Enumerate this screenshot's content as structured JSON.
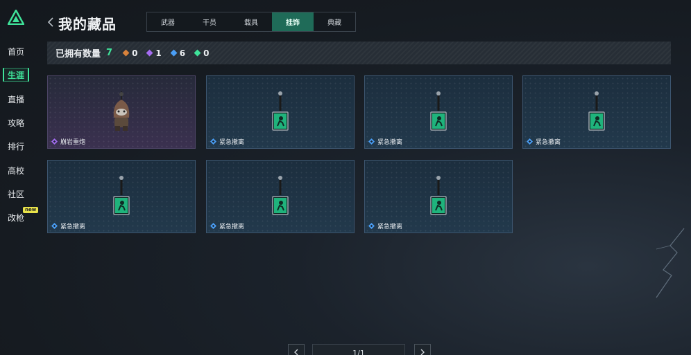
{
  "sidebar": {
    "items": [
      {
        "label": "首页",
        "active": false
      },
      {
        "label": "生涯",
        "active": true
      },
      {
        "label": "直播",
        "active": false
      },
      {
        "label": "攻略",
        "active": false
      },
      {
        "label": "排行",
        "active": false
      },
      {
        "label": "高校",
        "active": false
      },
      {
        "label": "社区",
        "active": false
      },
      {
        "label": "改枪",
        "active": false
      }
    ],
    "new_badge": "new"
  },
  "header": {
    "title": "我的藏品",
    "tabs": [
      {
        "label": "武器",
        "active": false
      },
      {
        "label": "干员",
        "active": false
      },
      {
        "label": "载具",
        "active": false
      },
      {
        "label": "挂饰",
        "active": true
      },
      {
        "label": "典藏",
        "active": false
      }
    ]
  },
  "stats": {
    "label": "已拥有数量",
    "total": "7",
    "rarities": [
      {
        "color": "#d9823b",
        "count": "0"
      },
      {
        "color": "#a46cf0",
        "count": "1"
      },
      {
        "color": "#4a9ef5",
        "count": "6"
      },
      {
        "color": "#3fe39a",
        "count": "0"
      }
    ]
  },
  "items": [
    {
      "name": "崩岩重炮",
      "rarity_color": "#a46cf0",
      "style": "purple",
      "art": "rock-creature"
    },
    {
      "name": "紧急撤离",
      "rarity_color": "#4a9ef5",
      "style": "blue",
      "art": "tag-charm"
    },
    {
      "name": "紧急撤离",
      "rarity_color": "#4a9ef5",
      "style": "blue",
      "art": "tag-charm"
    },
    {
      "name": "紧急撤离",
      "rarity_color": "#4a9ef5",
      "style": "blue",
      "art": "tag-charm"
    },
    {
      "name": "紧急撤离",
      "rarity_color": "#4a9ef5",
      "style": "blue",
      "art": "tag-charm"
    },
    {
      "name": "紧急撤离",
      "rarity_color": "#4a9ef5",
      "style": "blue",
      "art": "tag-charm"
    },
    {
      "name": "紧急撤离",
      "rarity_color": "#4a9ef5",
      "style": "blue",
      "art": "tag-charm"
    }
  ],
  "pagination": {
    "text": "1/1"
  }
}
